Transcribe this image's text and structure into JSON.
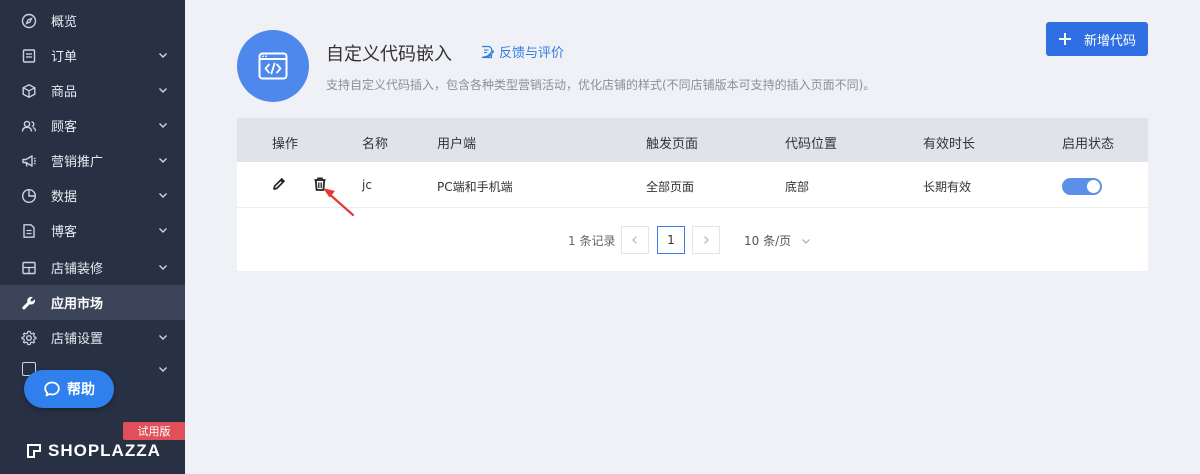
{
  "sidebar": {
    "items": [
      {
        "label": "概览",
        "icon": "compass-icon",
        "has_chevron": false
      },
      {
        "label": "订单",
        "icon": "order-icon",
        "has_chevron": true
      },
      {
        "label": "商品",
        "icon": "box-icon",
        "has_chevron": true
      },
      {
        "label": "顾客",
        "icon": "users-icon",
        "has_chevron": true
      },
      {
        "label": "营销推广",
        "icon": "megaphone-icon",
        "has_chevron": true
      },
      {
        "label": "数据",
        "icon": "pie-chart-icon",
        "has_chevron": true
      },
      {
        "label": "博客",
        "icon": "document-icon",
        "has_chevron": true
      },
      {
        "label": "店铺装修",
        "icon": "layout-icon",
        "has_chevron": true
      },
      {
        "label": "应用市场",
        "icon": "wrench-icon",
        "has_chevron": false,
        "active": true
      },
      {
        "label": "店铺设置",
        "icon": "gear-icon",
        "has_chevron": true
      }
    ],
    "help_label": "帮助",
    "trial_badge": "试用版",
    "logo_text": "SHOPLAZZA"
  },
  "header": {
    "title": "自定义代码嵌入",
    "feedback_label": "反馈与评价",
    "subtitle": "支持自定义代码插入，包含各种类型营销活动，优化店铺的样式(不同店铺版本可支持的插入页面不同)。",
    "add_button_label": "新增代码"
  },
  "table": {
    "columns": [
      "操作",
      "名称",
      "用户端",
      "触发页面",
      "代码位置",
      "有效时长",
      "启用状态"
    ],
    "rows": [
      {
        "name": "jc",
        "client": "PC端和手机端",
        "trigger_page": "全部页面",
        "position": "底部",
        "duration": "长期有效",
        "enabled": true
      }
    ]
  },
  "pagination": {
    "record_count": "1 条记录",
    "current_page": "1",
    "page_size": "10 条/页"
  },
  "colors": {
    "sidebar_bg": "#283044",
    "accent": "#2f6fe4",
    "toggle_on": "#5b8fe8",
    "annotation_arrow": "#e53935"
  }
}
